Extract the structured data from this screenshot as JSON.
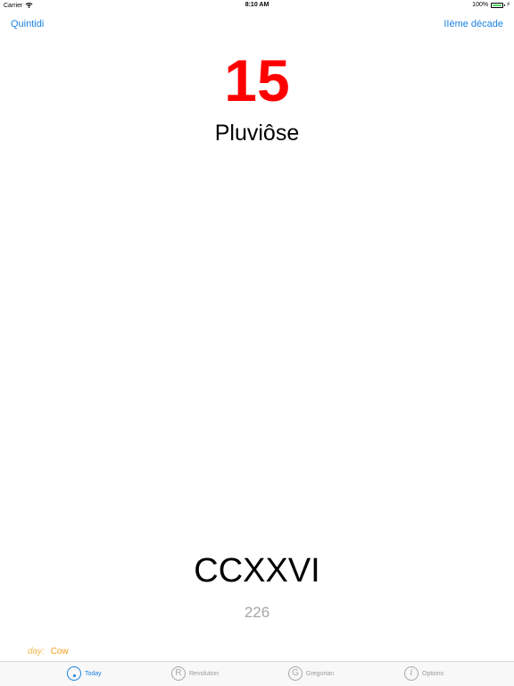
{
  "status_bar": {
    "carrier": "Carrier",
    "time": "8:10 AM",
    "battery_percent": "100%",
    "battery_level": 1.0,
    "battery_color": "#4cd964"
  },
  "nav": {
    "left": "Quintidi",
    "right": "IIème décade",
    "accent": "#1a82e2"
  },
  "date": {
    "day": "15",
    "day_color": "#ff0000",
    "month": "Pluviôse",
    "year_roman": "CCXXVI",
    "year_number": "226"
  },
  "day_info": {
    "label": "day:",
    "value": "Cow"
  },
  "tabs": [
    {
      "label": "Today",
      "icon": "dot-circle-icon",
      "glyph": "",
      "active": true
    },
    {
      "label": "Revolution",
      "icon": "r-circle-icon",
      "glyph": "R",
      "active": false
    },
    {
      "label": "Gregorian",
      "icon": "g-circle-icon",
      "glyph": "G",
      "active": false
    },
    {
      "label": "Options",
      "icon": "info-circle-icon",
      "glyph": "i",
      "active": false
    }
  ]
}
